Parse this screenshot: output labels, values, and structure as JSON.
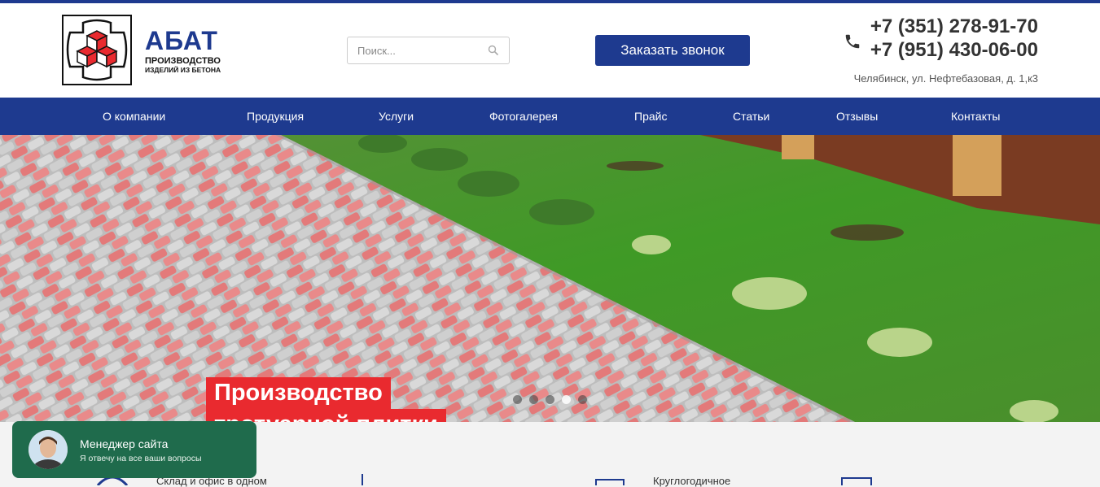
{
  "brand": {
    "name": "АБАТ",
    "subtitle_line1": "ПРОИЗВОДСТВО",
    "subtitle_line2": "ИЗДЕЛИЙ ИЗ БЕТОНА",
    "accent_color": "#1e3a8f",
    "logo_red": "#e92a2f"
  },
  "search": {
    "placeholder": "Поиск...",
    "value": "",
    "icon": "search-icon"
  },
  "header": {
    "callback_label": "Заказать звонок",
    "phone_icon": "phone-icon",
    "phones": [
      "+7 (351) 278-91-70",
      "+7 (951) 430-06-00"
    ],
    "address": "Челябинск, ул. Нефтебазовая, д. 1,к3"
  },
  "nav": {
    "items": [
      "О компании",
      "Продукция",
      "Услуги",
      "Фотогалерея",
      "Прайс",
      "Статьи",
      "Отзывы",
      "Контакты"
    ]
  },
  "hero": {
    "line1": "Производство",
    "line2": "тротуарной плитки",
    "slides_total": 5,
    "active_slide": 4
  },
  "features": {
    "item1": "Склад и офис в одном",
    "item3": "Круглогодичное"
  },
  "chat": {
    "title": "Менеджер сайта",
    "subtitle": "Я отвечу на все ваши вопросы",
    "color": "#1f6b4c"
  }
}
